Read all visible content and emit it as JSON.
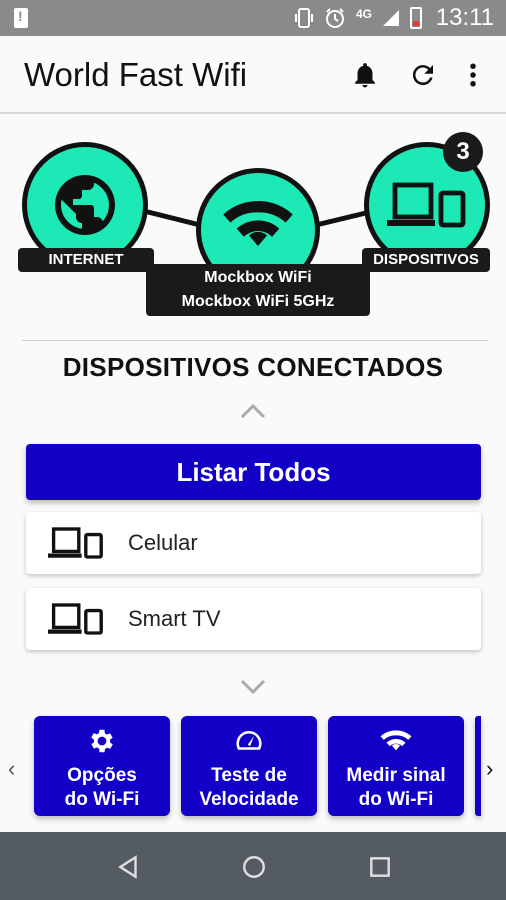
{
  "status_bar": {
    "network": "4G",
    "time": "13:11"
  },
  "app_bar": {
    "title": "World Fast Wifi"
  },
  "network_map": {
    "internet_label": "INTERNET",
    "wifi_names": [
      "Mockbox WiFi",
      "Mockbox WiFi 5GHz"
    ],
    "devices_label": "DISPOSITIVOS",
    "device_count": "3",
    "accent_color": "#1de9b6"
  },
  "connected": {
    "title": "DISPOSITIVOS CONECTADOS",
    "list_all_label": "Listar Todos",
    "devices": [
      {
        "label": "Celular"
      },
      {
        "label": "Smart TV"
      }
    ]
  },
  "shortcuts": [
    {
      "icon": "gear-icon",
      "line1": "Opções",
      "line2": "do Wi-Fi"
    },
    {
      "icon": "speedometer-icon",
      "line1": "Teste de",
      "line2": "Velocidade"
    },
    {
      "icon": "wifi-icon",
      "line1": "Medir sinal",
      "line2": "do Wi-Fi"
    }
  ],
  "colors": {
    "primary": "#1300c7",
    "accent": "#1de9b6"
  }
}
